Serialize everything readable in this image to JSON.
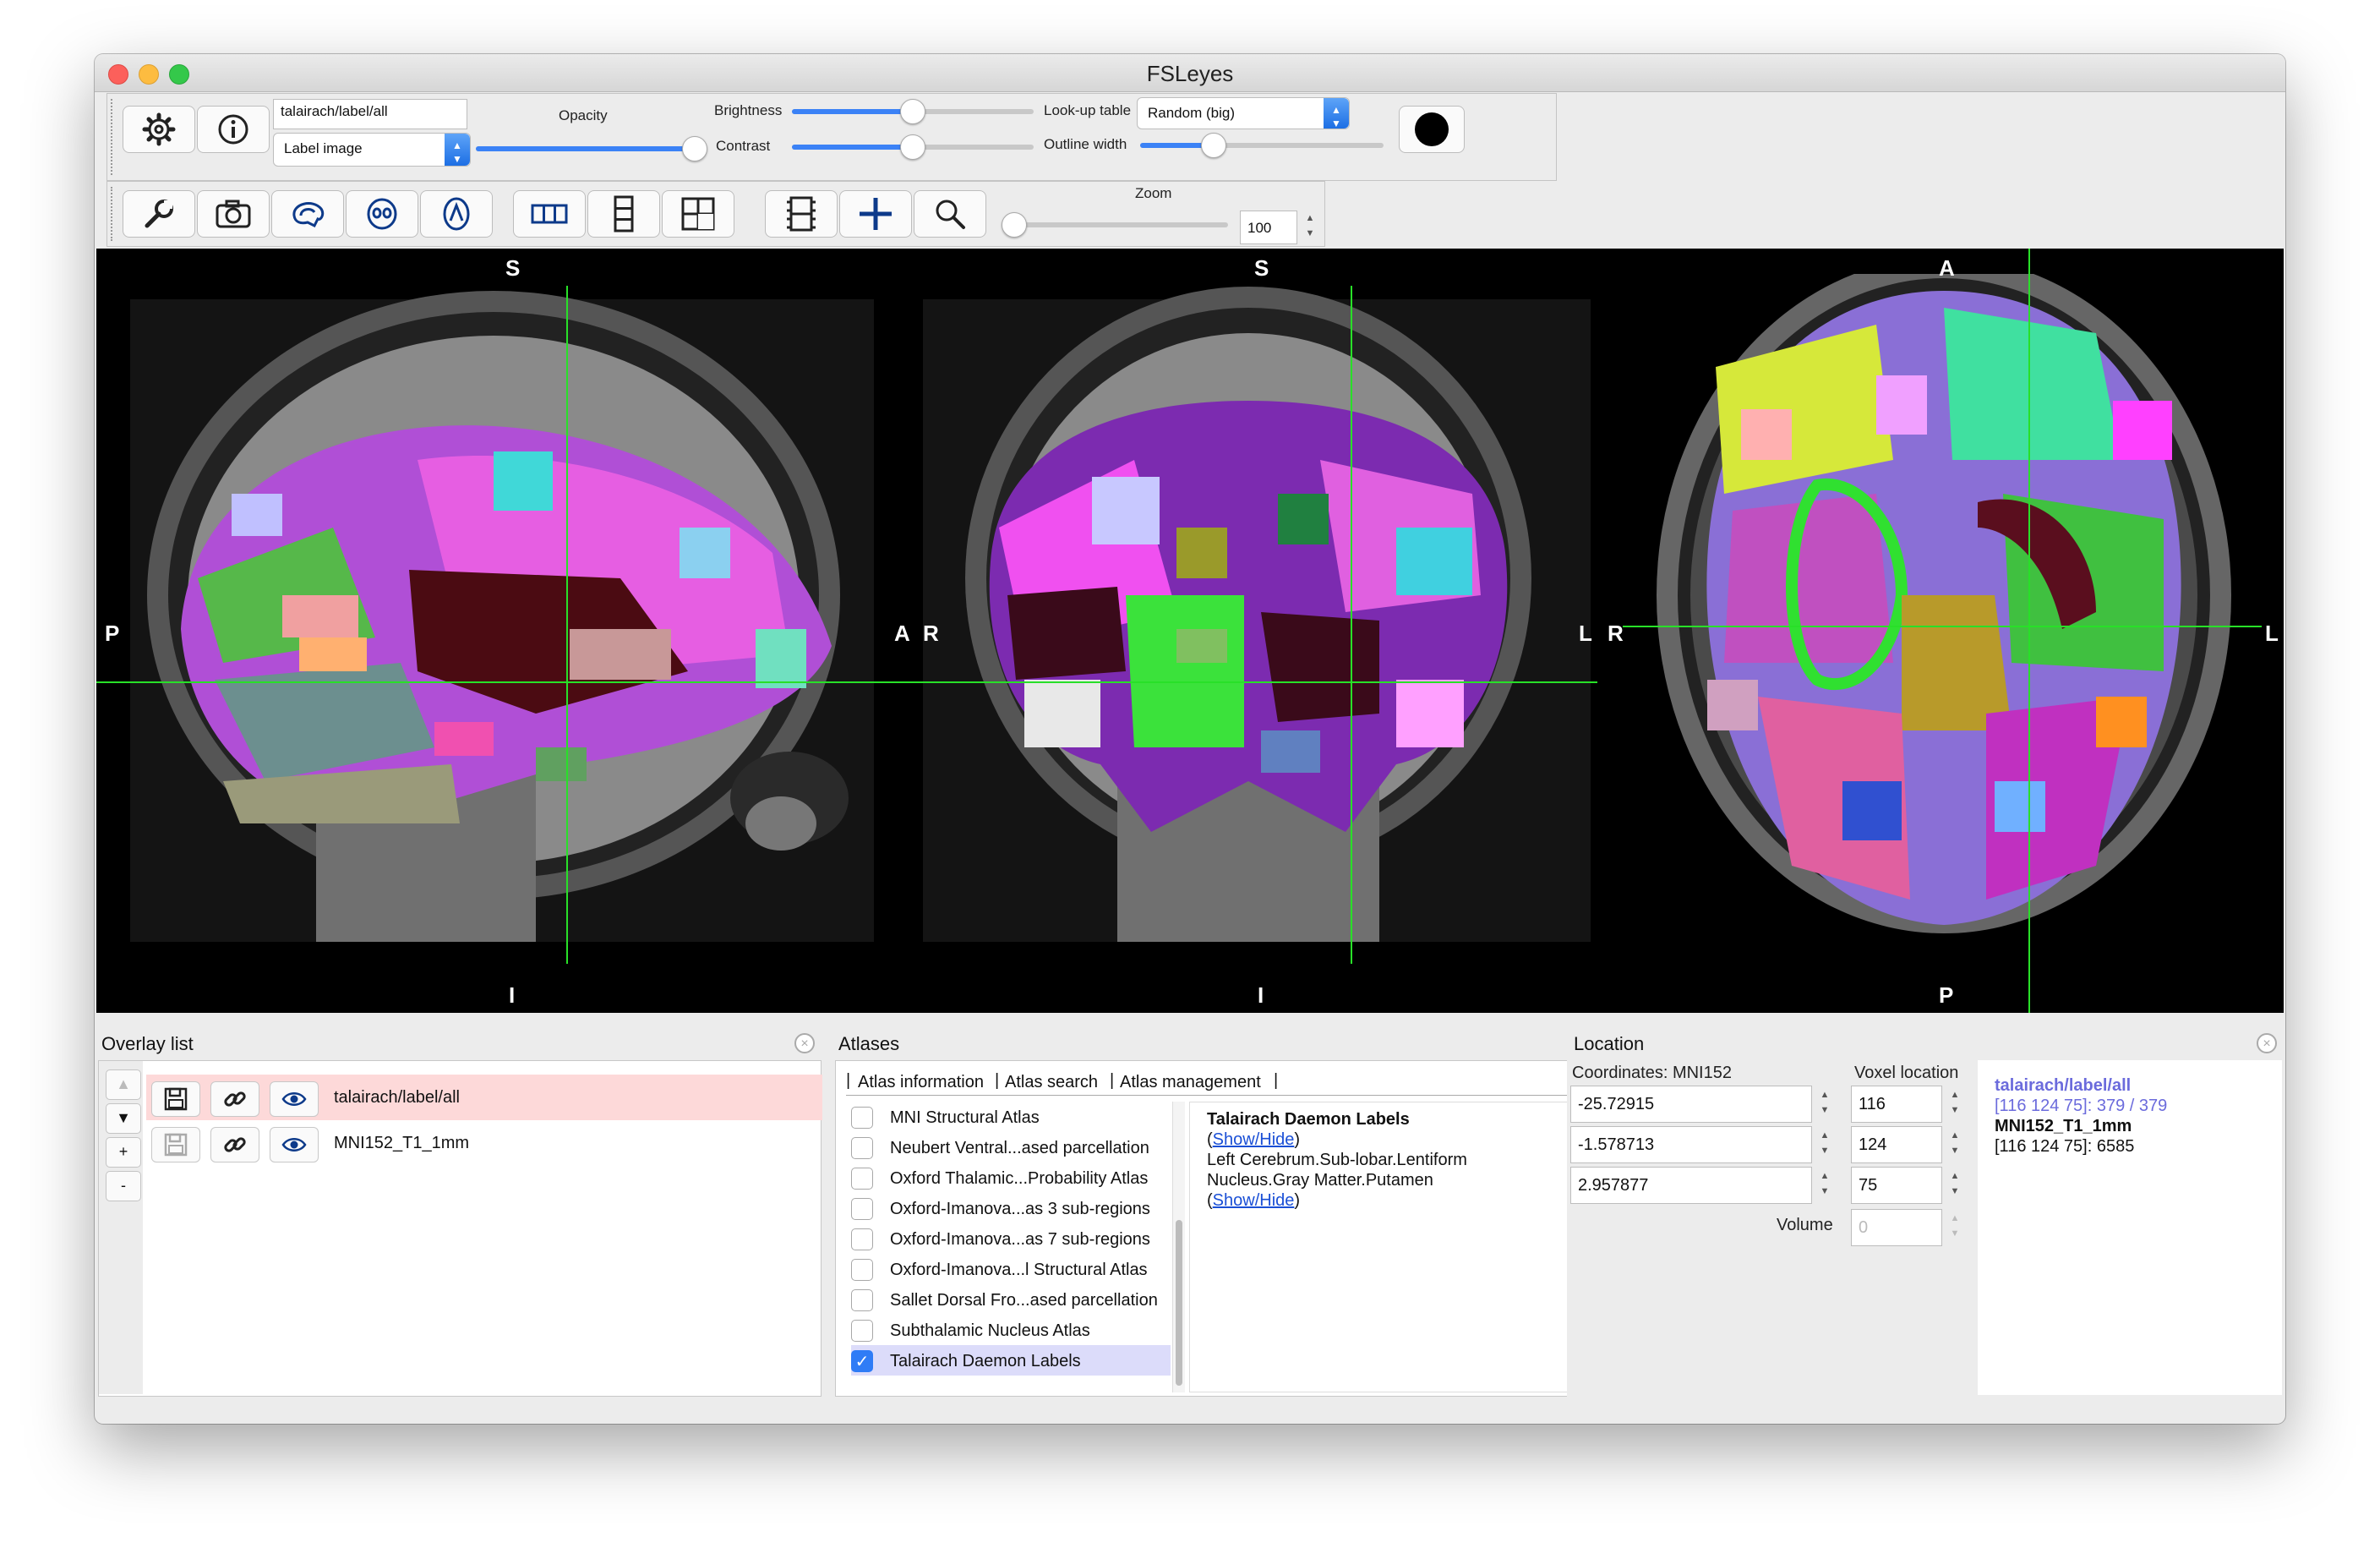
{
  "window": {
    "title": "FSLeyes"
  },
  "overlay_toolbar": {
    "overlay_name": "talairach/label/all",
    "overlay_type": "Label image",
    "opacity_label": "Opacity",
    "opacity": 1.0,
    "brightness_label": "Brightness",
    "brightness": 0.5,
    "contrast_label": "Contrast",
    "contrast": 0.5,
    "lut_label": "Look-up table",
    "lut_value": "Random (big)",
    "outline_label": "Outline width",
    "outline_width": 0.3,
    "colour_swatch": "#000000",
    "icons": [
      "gear-icon",
      "info-icon"
    ]
  },
  "ortho_toolbar": {
    "zoom_label": "Zoom",
    "zoom_value": "100",
    "zoom": 0.0,
    "icons": [
      "wrench-icon",
      "camera-icon",
      "sagittal-icon",
      "coronal-icon",
      "axial-icon",
      "layout-horizontal-icon",
      "layout-vertical-icon",
      "layout-grid-icon",
      "movie-icon",
      "crosshair-icon",
      "zoom-icon"
    ]
  },
  "views": {
    "sagittal": {
      "top": "S",
      "bottom": "I",
      "left": "P",
      "right": "A"
    },
    "coronal": {
      "top": "S",
      "bottom": "I",
      "left": "R",
      "right": "L"
    },
    "axial": {
      "top": "A",
      "bottom": "P",
      "left": "R",
      "right": "L"
    },
    "crosshair_color": "#28e028"
  },
  "overlay_list": {
    "title": "Overlay list",
    "side_buttons": [
      "▲",
      "▼",
      "+",
      "-"
    ],
    "items": [
      {
        "name": "talairach/label/all",
        "selected": true
      },
      {
        "name": "MNI152_T1_1mm",
        "selected": false
      }
    ],
    "selected_color": "#fdd9d9"
  },
  "atlases": {
    "title": "Atlases",
    "tabs": [
      "Atlas information",
      "Atlas search",
      "Atlas management"
    ],
    "items": [
      {
        "label": "MNI Structural Atlas",
        "checked": false
      },
      {
        "label": "Neubert Ventral...ased parcellation",
        "checked": false
      },
      {
        "label": "Oxford Thalamic...Probability Atlas",
        "checked": false
      },
      {
        "label": "Oxford-Imanova...as 3 sub-regions",
        "checked": false
      },
      {
        "label": "Oxford-Imanova...as 7 sub-regions",
        "checked": false
      },
      {
        "label": "Oxford-Imanova...l Structural Atlas",
        "checked": false
      },
      {
        "label": "Sallet Dorsal Fro...ased parcellation",
        "checked": false
      },
      {
        "label": "Subthalamic Nucleus Atlas",
        "checked": false
      },
      {
        "label": "Talairach Daemon Labels",
        "checked": true
      }
    ],
    "info": {
      "atlas_name": "Talairach Daemon Labels",
      "paren_open": "(",
      "paren_close": ")",
      "show_hide_1": "Show/Hide",
      "label_line1": "Left Cerebrum.Sub-lobar.Lentiform",
      "label_line2": "Nucleus.Gray Matter.Putamen",
      "show_hide_2": "Show/Hide"
    }
  },
  "location": {
    "title": "Location",
    "coords_label": "Coordinates: MNI152",
    "voxel_label": "Voxel location",
    "world": [
      "-25.72915",
      "-1.578713",
      "2.957877"
    ],
    "voxel": [
      "116",
      "124",
      "75"
    ],
    "volume_label": "Volume",
    "volume_value": "0",
    "info": {
      "overlay1_name": "talairach/label/all",
      "overlay1_value": "[116 124 75]: 379 / 379",
      "overlay2_name": "MNI152_T1_1mm",
      "overlay2_value": "[116 124 75]: 6585",
      "overlay1_color": "#6b6bdc"
    }
  }
}
